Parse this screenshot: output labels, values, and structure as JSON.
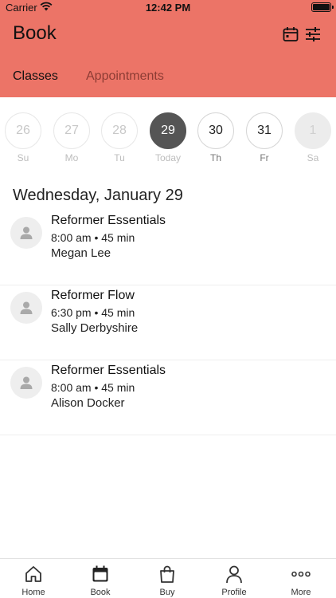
{
  "status_bar": {
    "carrier": "Carrier",
    "time": "12:42 PM"
  },
  "header": {
    "title": "Book",
    "tabs": [
      {
        "label": "Classes",
        "active": true
      },
      {
        "label": "Appointments",
        "active": false
      }
    ],
    "accent_color": "#ec7467"
  },
  "date_strip": {
    "days": [
      {
        "num": "26",
        "label": "Su",
        "state": "past"
      },
      {
        "num": "27",
        "label": "Mo",
        "state": "past"
      },
      {
        "num": "28",
        "label": "Tu",
        "state": "past"
      },
      {
        "num": "29",
        "label": "Today",
        "state": "selected"
      },
      {
        "num": "30",
        "label": "Th",
        "state": "future"
      },
      {
        "num": "31",
        "label": "Fr",
        "state": "future"
      },
      {
        "num": "1",
        "label": "Sa",
        "state": "disabled"
      }
    ]
  },
  "schedule": {
    "heading": "Wednesday, January 29",
    "classes": [
      {
        "name": "Reformer Essentials",
        "time": "8:00 am • 45 min",
        "instructor": "Megan Lee"
      },
      {
        "name": "Reformer Flow",
        "time": "6:30 pm • 45 min",
        "instructor": "Sally Derbyshire"
      },
      {
        "name": "Reformer Essentials",
        "time": "8:00 am • 45 min",
        "instructor": "Alison Docker"
      }
    ]
  },
  "tabbar": {
    "items": [
      {
        "label": "Home",
        "icon": "home-icon"
      },
      {
        "label": "Book",
        "icon": "calendar-icon",
        "active": true
      },
      {
        "label": "Buy",
        "icon": "shopping-bag-icon"
      },
      {
        "label": "Profile",
        "icon": "person-icon"
      },
      {
        "label": "More",
        "icon": "more-dots-icon"
      }
    ]
  }
}
